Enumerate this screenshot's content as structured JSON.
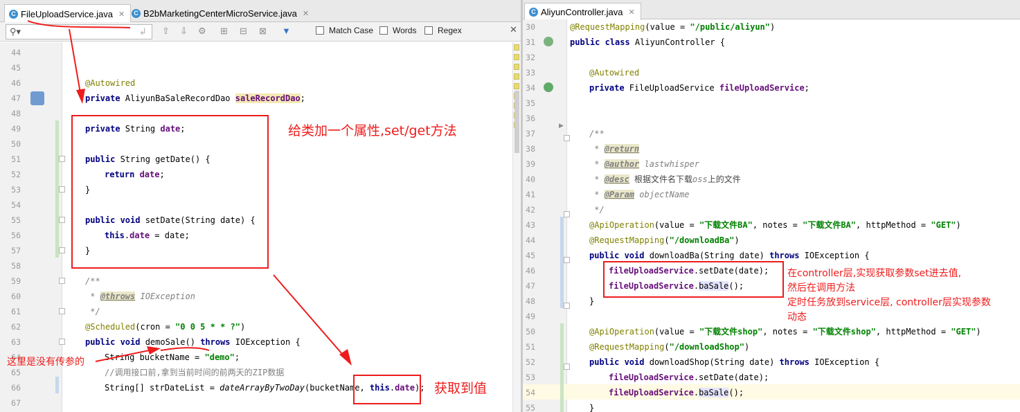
{
  "left": {
    "tabs": [
      {
        "label": "FileUploadService.java",
        "close": "✕"
      },
      {
        "label": "B2bMarketingCenterMicroService.java",
        "close": "✕"
      }
    ],
    "find": {
      "value": "",
      "match_case": "Match Case",
      "words": "Words",
      "regex": "Regex",
      "close": "✕"
    },
    "lines": [
      {
        "n": "44"
      },
      {
        "n": "45"
      },
      {
        "n": "46"
      },
      {
        "n": "47"
      },
      {
        "n": "48"
      },
      {
        "n": "49"
      },
      {
        "n": "50"
      },
      {
        "n": "51"
      },
      {
        "n": "52"
      },
      {
        "n": "53"
      },
      {
        "n": "54"
      },
      {
        "n": "55"
      },
      {
        "n": "56"
      },
      {
        "n": "57"
      },
      {
        "n": "58"
      },
      {
        "n": "59"
      },
      {
        "n": "60"
      },
      {
        "n": "61"
      },
      {
        "n": "62"
      },
      {
        "n": "63"
      },
      {
        "n": "64"
      },
      {
        "n": "65"
      },
      {
        "n": "66"
      },
      {
        "n": "67"
      }
    ],
    "code": {
      "l46": "@Autowired",
      "l47a": "private ",
      "l47b": "AliyunBaSaleRecordDao ",
      "l47c": "saleRecordDao",
      "l47d": ";",
      "l49a": "private ",
      "l49b": "String ",
      "l49c": "date",
      "l49d": ";",
      "l51a": "public ",
      "l51b": "String getDate() {",
      "l52a": "return ",
      "l52b": "date",
      "l52c": ";",
      "l53": "}",
      "l55a": "public void ",
      "l55b": "setDate(String date) {",
      "l56a": "this",
      "l56b": ".",
      "l56c": "date",
      "l56d": " = date;",
      "l57": "}",
      "l59": "/**",
      "l60a": " * ",
      "l60b": "@throws",
      "l60c": " IOException",
      "l61": " */",
      "l62a": "@Scheduled",
      "l62b": "(cron = ",
      "l62c": "\"0 0 5 * * ?\"",
      "l62d": ")",
      "l63a": "public void ",
      "l63b": "demoSale() ",
      "l63c": "throws ",
      "l63d": "IOException {",
      "l64a": "String bucketName = ",
      "l64b": "\"demo\"",
      "l64c": ";",
      "l65": "//调用接口前,拿到当前时间的前两天的ZIP数据",
      "l66a": "String[] strDateList = ",
      "l66b": "dateArrayByTwoDay",
      "l66c": "(bucketName, ",
      "l66d": "this",
      "l66e": ".",
      "l66f": "date",
      "l66g": ");"
    },
    "notes": {
      "add_field": "给类加一个属性,set/get方法",
      "no_param": "这里是没有传参的",
      "get_value": "获取到值"
    }
  },
  "right": {
    "tabs": [
      {
        "label": "AliyunController.java",
        "close": "✕"
      }
    ],
    "lines": [
      {
        "n": "30"
      },
      {
        "n": "31"
      },
      {
        "n": "32"
      },
      {
        "n": "33"
      },
      {
        "n": "34"
      },
      {
        "n": "35"
      },
      {
        "n": "36"
      },
      {
        "n": "37"
      },
      {
        "n": "38"
      },
      {
        "n": "39"
      },
      {
        "n": "40"
      },
      {
        "n": "41"
      },
      {
        "n": "42"
      },
      {
        "n": "43"
      },
      {
        "n": "44"
      },
      {
        "n": "45"
      },
      {
        "n": "46"
      },
      {
        "n": "47"
      },
      {
        "n": "48"
      },
      {
        "n": "49"
      },
      {
        "n": "50"
      },
      {
        "n": "51"
      },
      {
        "n": "52"
      },
      {
        "n": "53"
      },
      {
        "n": "54"
      },
      {
        "n": "55"
      }
    ],
    "code": {
      "r30a": "@RequestMapping",
      "r30b": "(value = ",
      "r30c": "\"/public/aliyun\"",
      "r30d": ")",
      "r31a": "public class ",
      "r31b": "AliyunController {",
      "r33": "@Autowired",
      "r34a": "private ",
      "r34b": "FileUploadService ",
      "r34c": "fileUploadService",
      "r34d": ";",
      "r37": "/**",
      "r38a": " * ",
      "r38b": "@return",
      "r39a": " * ",
      "r39b": "@author",
      "r39c": " lastwhisper",
      "r40a": " * ",
      "r40b": "@desc",
      "r40c": " 根据文件名下载",
      "r40d": "oss",
      "r40e": "上的文件",
      "r41a": " * ",
      "r41b": "@Param",
      "r41c": " objectName",
      "r42": " */",
      "r43a": "@ApiOperation",
      "r43b": "(value = ",
      "r43c": "\"下载文件BA\"",
      "r43d": ", notes = ",
      "r43e": "\"下载文件BA\"",
      "r43f": ", httpMethod = ",
      "r43g": "\"GET\"",
      "r43h": ")",
      "r44a": "@RequestMapping",
      "r44b": "(",
      "r44c": "\"/downloadBa\"",
      "r44d": ")",
      "r45a": "public void ",
      "r45b": "downloadBa(String date) ",
      "r45c": "throws ",
      "r45d": "IOException {",
      "r46a": "fileUploadService",
      "r46b": ".setDate(date);",
      "r47a": "fileUploadService",
      "r47b": ".",
      "r47c": "baSale",
      "r47d": "();",
      "r48": "}",
      "r50a": "@ApiOperation",
      "r50b": "(value = ",
      "r50c": "\"下载文件shop\"",
      "r50d": ", notes = ",
      "r50e": "\"下载文件shop\"",
      "r50f": ", httpMethod = ",
      "r50g": "\"GET\"",
      "r50h": ")",
      "r51a": "@RequestMapping",
      "r51b": "(",
      "r51c": "\"/downloadShop\"",
      "r51d": ")",
      "r52a": "public void ",
      "r52b": "downloadShop(String date) ",
      "r52c": "throws ",
      "r52d": "IOException {",
      "r53a": "fileUploadService",
      "r53b": ".setDate(date);",
      "r54a": "fileUploadService",
      "r54b": ".",
      "r54c": "baSale",
      "r54d": "();",
      "r55": "}"
    },
    "notes": {
      "line1": "在controller层,实现获取参数set进去值,",
      "line2": "然后在调用方法",
      "line3": "定时任务放到service层, controller层实现参数",
      "line4": "动态"
    }
  },
  "colors": {
    "annotation_red": "#ee1c1c",
    "keyword": "#000080",
    "field": "#660e7a",
    "string": "#008000",
    "annotation": "#808000",
    "comment": "#808080",
    "changed_line": "#c9e5c1",
    "modified_line": "#c6d7ee"
  },
  "icons": [
    "class-file-icon",
    "close-icon",
    "search-icon",
    "previous-occurrence-icon",
    "next-occurrence-icon",
    "find-in-path-icon",
    "filter-icon",
    "bean-icon",
    "implemented-method-icon"
  ]
}
